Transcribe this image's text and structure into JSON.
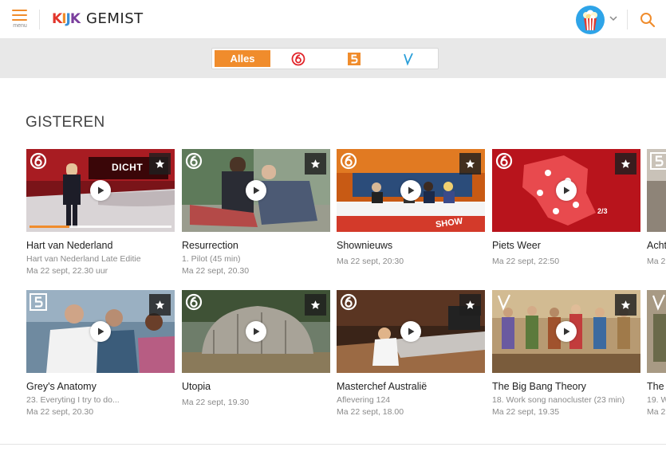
{
  "header": {
    "menu_label": "menu",
    "logo_mark": "KIJK",
    "logo_text": "GEMIST",
    "accent_color": "#f08c2c",
    "icons": [
      "hamburger-icon",
      "popcorn-icon",
      "chevron-down-icon",
      "search-icon"
    ]
  },
  "filter": {
    "all_label": "Alles",
    "active": "Alles",
    "channels": [
      "SBS6",
      "NET5",
      "Veronica"
    ]
  },
  "section": {
    "title": "GISTEREN"
  },
  "rows": [
    [
      {
        "title": "Hart van Nederland",
        "subtitle": "Hart van Nederland Late Editie",
        "date": "Ma 22 sept, 22.30 uur",
        "channel": "SBS6",
        "thumb_text": "DICHT",
        "progress": 0.28
      },
      {
        "title": "Resurrection",
        "subtitle": "1. Pilot (45 min)",
        "date": "Ma 22 sept, 20.30",
        "channel": "SBS6"
      },
      {
        "title": "Shownieuws",
        "subtitle": "",
        "date": "Ma 22 sept, 20:30",
        "channel": "SBS6",
        "thumb_text": "SHOW"
      },
      {
        "title": "Piets Weer",
        "subtitle": "",
        "date": "Ma 22 sept, 22:50",
        "channel": "SBS6",
        "thumb_text": "2/3"
      },
      {
        "title": "Acht",
        "subtitle": "",
        "date": "Ma 2",
        "channel": "NET5"
      }
    ],
    [
      {
        "title": "Grey's Anatomy",
        "subtitle": "23. Everyting I try to do...",
        "date": "Ma 22 sept, 20.30",
        "channel": "NET5"
      },
      {
        "title": "Utopia",
        "subtitle": "",
        "date": "Ma 22 sept, 19.30",
        "channel": "SBS6"
      },
      {
        "title": "Masterchef Australië",
        "subtitle": "Aflevering 124",
        "date": "Ma 22 sept, 18.00",
        "channel": "SBS6"
      },
      {
        "title": "The Big Bang Theory",
        "subtitle": "18. Work song nanocluster (23 min)",
        "date": "Ma 22 sept, 19.35",
        "channel": "Veronica"
      },
      {
        "title": "The",
        "subtitle": "19. W",
        "date": "Ma 2",
        "channel": "Veronica"
      }
    ]
  ]
}
